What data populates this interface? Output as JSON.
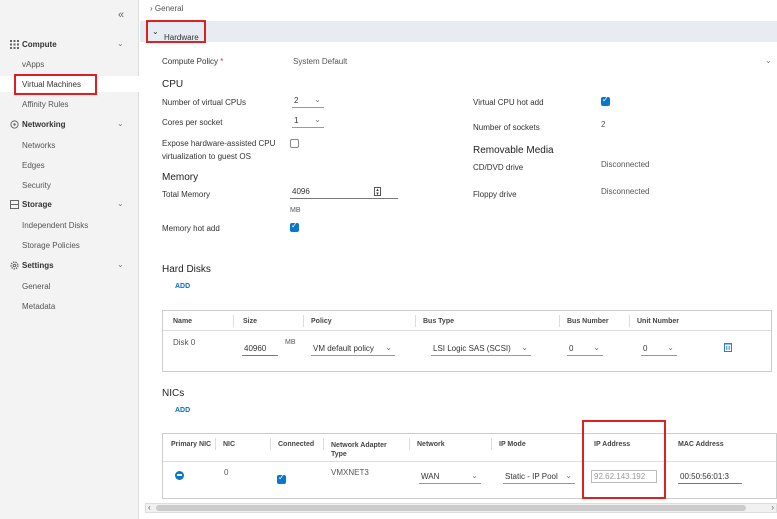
{
  "sidebar": {
    "collapse": "«",
    "groups": {
      "compute": "Compute",
      "networking": "Networking",
      "storage": "Storage",
      "settings": "Settings"
    },
    "items": {
      "vapps": "vApps",
      "virtual_machines": "Virtual Machines",
      "affinity_rules": "Affinity Rules",
      "networks": "Networks",
      "edges": "Edges",
      "security": "Security",
      "independent_disks": "Independent Disks",
      "storage_policies": "Storage Policies",
      "general": "General",
      "metadata": "Metadata"
    }
  },
  "sections": {
    "general": "General",
    "hardware": "Hardware"
  },
  "hardware": {
    "compute_policy_label": "Compute Policy",
    "required_mark": "*",
    "compute_policy_value": "System Default",
    "cpu_heading": "CPU",
    "num_cpus_label": "Number of virtual CPUs",
    "num_cpus_value": "2",
    "cores_label": "Cores per socket",
    "cores_value": "1",
    "expose_label_1": "Expose hardware-assisted CPU",
    "expose_label_2": "virtualization to guest OS",
    "cpu_hot_add_label": "Virtual CPU hot add",
    "sockets_label": "Number of sockets",
    "sockets_value": "2",
    "removable_heading": "Removable Media",
    "cd_label": "CD/DVD drive",
    "cd_value": "Disconnected",
    "floppy_label": "Floppy drive",
    "floppy_value": "Disconnected",
    "memory_heading": "Memory",
    "total_memory_label": "Total Memory",
    "total_memory_value": "4096",
    "memory_unit": "MB",
    "memory_hot_add_label": "Memory hot add",
    "checkboxes": {
      "cpu_hot_add": true,
      "expose": false,
      "memory_hot_add": true
    }
  },
  "hard_disks": {
    "heading": "Hard Disks",
    "add": "ADD",
    "columns": [
      "Name",
      "Size",
      "Policy",
      "Bus Type",
      "Bus Number",
      "Unit Number"
    ],
    "row": {
      "name": "Disk 0",
      "size": "40960",
      "unit": "MB",
      "policy": "VM default policy",
      "bus_type": "LSI Logic SAS (SCSI)",
      "bus_number": "0",
      "unit_number": "0"
    }
  },
  "nics": {
    "heading": "NICs",
    "add": "ADD",
    "columns": [
      "Primary NIC",
      "NIC",
      "Connected",
      "Network Adapter Type",
      "Network",
      "IP Mode",
      "IP Address",
      "MAC Address"
    ],
    "row": {
      "nic": "0",
      "adapter": "VMXNET3",
      "network": "WAN",
      "ip_mode": "Static - IP Pool",
      "ip_address": "92.62.143.192",
      "mac": "00:50:56:01:3"
    }
  },
  "icons": {
    "chevron_down": "⌄",
    "chevron_right": "›",
    "chevron_left": "‹",
    "trash": "🗑"
  },
  "colors": {
    "accent": "#0a78c8",
    "highlight": "#e02020",
    "header_band": "#e6ecf1"
  }
}
